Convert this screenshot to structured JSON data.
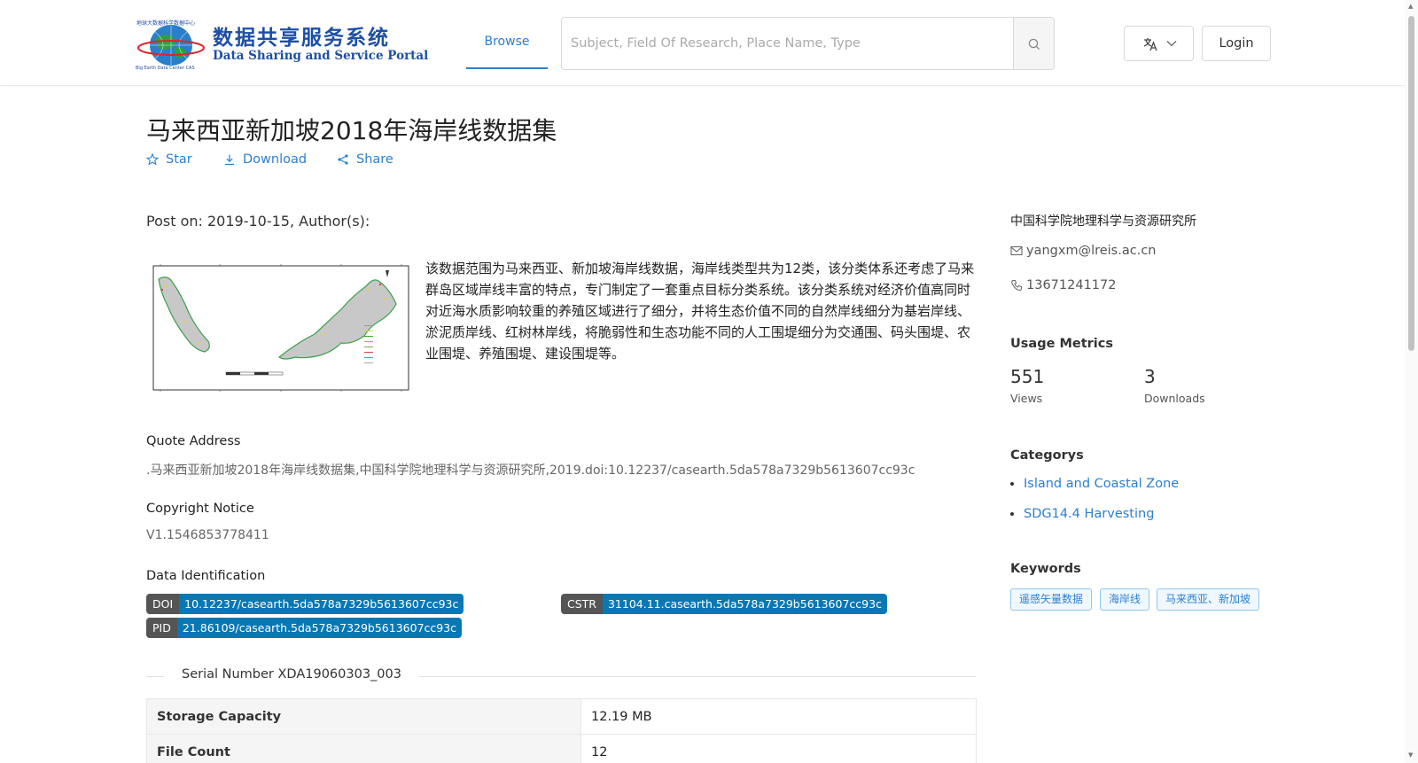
{
  "header": {
    "logo": {
      "title": "数据共享服务系统",
      "subtitle": "Data Sharing and Service Portal",
      "tiny_cn": "地球大数据科学数据中心",
      "tiny_en": "Big Earth Data Center CAS"
    },
    "nav": {
      "browse": "Browse"
    },
    "search": {
      "placeholder": "Subject, Field Of Research, Place Name, Type",
      "value": ""
    },
    "login": "Login"
  },
  "dataset": {
    "title": "马来西亚新加坡2018年海岸线数据集",
    "actions": {
      "star": "Star",
      "download": "Download",
      "share": "Share"
    },
    "post_on": "Post on: 2019-10-15, Author(s):",
    "description": "该数据范围为马来西亚、新加坡海岸线数据，海岸线类型共为12类，该分类体系还考虑了马来群岛区域岸线丰富的特点，专门制定了一套重点目标分类系统。该分类系统对经济价值高同时对近海水质影响较重的养殖区域进行了细分，并将生态价值不同的自然岸线细分为基岩岸线、淤泥质岸线、红树林岸线，将脆弱性和生态功能不同的人工围堤细分为交通围、码头围堤、农业围堤、养殖围堤、建设围堤等。",
    "quote": {
      "label": "Quote Address",
      "value": ".马来西亚新加坡2018年海岸线数据集,中国科学院地理科学与资源研究所,2019.doi:10.12237/casearth.5da578a7329b5613607cc93c"
    },
    "copyright": {
      "label": "Copyright Notice",
      "value": "V1.1546853778411"
    },
    "identification": {
      "label": "Data Identification",
      "doi": {
        "key": "DOI",
        "value": "10.12237/casearth.5da578a7329b5613607cc93c"
      },
      "cstr": {
        "key": "CSTR",
        "value": "31104.11.casearth.5da578a7329b5613607cc93c"
      },
      "pid": {
        "key": "PID",
        "value": "21.86109/casearth.5da578a7329b5613607cc93c"
      }
    },
    "serial": "Serial Number XDA19060303_003",
    "table": [
      {
        "key": "Storage Capacity",
        "value": "12.19 MB"
      },
      {
        "key": "File Count",
        "value": "12"
      }
    ]
  },
  "sidebar": {
    "org": "中国科学院地理科学与资源研究所",
    "email": "yangxm@lreis.ac.cn",
    "phone": "13671241172",
    "usage": {
      "heading": "Usage Metrics",
      "views": {
        "value": "551",
        "label": "Views"
      },
      "downloads": {
        "value": "3",
        "label": "Downloads"
      }
    },
    "categories": {
      "heading": "Categorys",
      "items": [
        "Island and Coastal Zone",
        "SDG14.4 Harvesting"
      ]
    },
    "keywords": {
      "heading": "Keywords",
      "items": [
        "遥感矢量数据",
        "海岸线",
        "马来西亚、新加坡"
      ]
    }
  }
}
